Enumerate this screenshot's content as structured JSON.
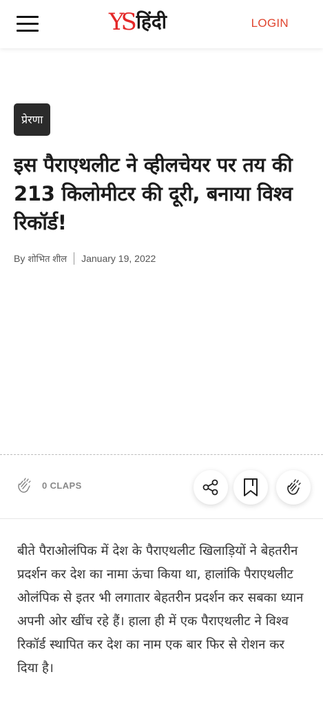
{
  "header": {
    "logo_brand": "YS",
    "logo_language": "हिंदी",
    "login_label": "LOGIN"
  },
  "article": {
    "category": "प्रेरणा",
    "title": "इस पैराएथलीट ने व्हीलचेयर पर तय की 213 किलोमीटर की दूरी, बनाया विश्व रिकॉर्ड!",
    "by_label": "By",
    "author": "शोभित शील",
    "date": "January 19, 2022",
    "body": "बीते पैराओलंपिक में देश के पैराएथलीट खिलाड़ियों ने बेहतरीन प्रदर्शन कर देश का नामा ऊंचा किया था, हालांकि पैराएथलीट ओलंपिक से इतर भी लगातार बेहतरीन प्रदर्शन कर सबका ध्यान अपनी ओर खींच रहे हैं। हाला ही में एक पैराएथलीट ने विश्व रिकॉर्ड स्थापित कर देश का नाम एक बार फिर से रोशन कर दिया है।"
  },
  "actions": {
    "claps_label": "0 CLAPS",
    "icons": [
      "clap-icon",
      "share-icon",
      "bookmark-icon",
      "clap-icon"
    ]
  },
  "colors": {
    "brand_red": "#e42828",
    "login": "#e0452f",
    "tag_bg": "#2b2b2b"
  }
}
